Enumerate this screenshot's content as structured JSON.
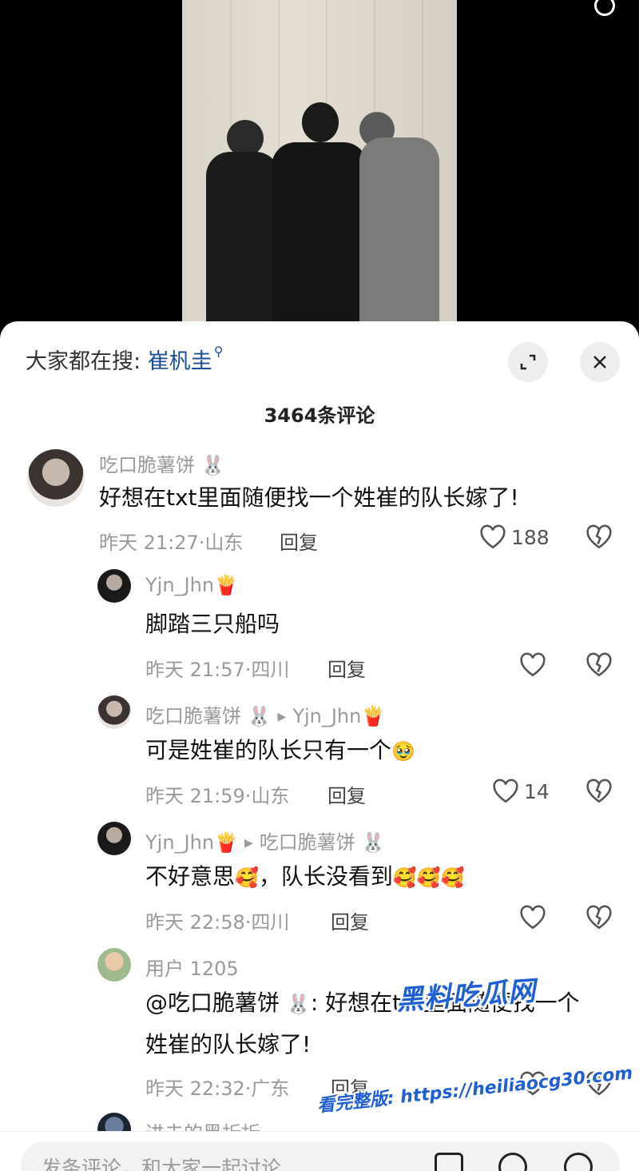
{
  "hot_search": {
    "prefix": "大家都在搜:",
    "keyword": "崔杋圭"
  },
  "comments_count": "3464条评论",
  "comments": [
    {
      "user": "吃口脆薯饼",
      "user_emoji": "🐰",
      "text": "好想在txt里面随便找一个姓崔的队长嫁了!",
      "time": "昨天 21:27·山东",
      "reply": "回复",
      "likes": "188"
    },
    {
      "user": "Yjn_Jhn",
      "user_emoji": "🍟",
      "text": "脚踏三只船吗",
      "time": "昨天 21:57·四川",
      "reply": "回复",
      "likes": ""
    },
    {
      "user": "吃口脆薯饼",
      "user_emoji": "🐰",
      "reply_to": "Yjn_Jhn",
      "reply_to_emoji": "🍟",
      "text": "可是姓崔的队长只有一个",
      "text_emoji": "🥹",
      "time": "昨天 21:59·山东",
      "reply": "回复",
      "likes": "14"
    },
    {
      "user": "Yjn_Jhn",
      "user_emoji": "🍟",
      "reply_to": "吃口脆薯饼",
      "reply_to_emoji": "🐰",
      "text_a": "不好意思",
      "text_emoji_a": "🥰",
      "text_b": "，队长没看到",
      "text_emoji_b": "🥰🥰🥰",
      "time": "昨天 22:58·四川",
      "reply": "回复",
      "likes": ""
    },
    {
      "user": "用户 1205",
      "text_line1_a": "@吃口脆薯饼",
      "text_line1_emoji": "🐰",
      "text_line1_b": ": 好想在txt里面随便找一个",
      "text_line2": "姓崔的队长嫁了!",
      "time": "昨天 22:32·广东",
      "reply": "回复",
      "likes": ""
    },
    {
      "user": "进击的黑折折"
    }
  ],
  "input": {
    "placeholder": "发条评论，和大家一起讨论"
  },
  "watermark": {
    "brand": "黑料吃瓜网",
    "url_text": "看完整版: https://heiliaocg30.com"
  },
  "icons": [
    "search-icon",
    "expand-icon",
    "close-icon",
    "heart-icon",
    "broken-heart-icon",
    "image-icon",
    "at-icon",
    "emoji-icon"
  ]
}
